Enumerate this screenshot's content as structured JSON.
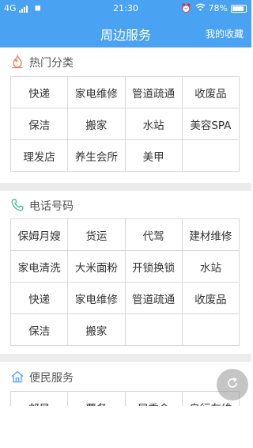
{
  "status": {
    "network": "4G",
    "time": "21:30",
    "battery": "78%"
  },
  "navbar": {
    "title": "周边服务",
    "favorites": "我的收藏"
  },
  "sections": {
    "hot": {
      "title": "热门分类",
      "icon": "flame-icon",
      "icon_color": "#f07d4f",
      "rows": [
        [
          "快递",
          "家电维修",
          "管道疏通",
          "收废品"
        ],
        [
          "保洁",
          "搬家",
          "水站",
          "美容SPA"
        ],
        [
          "理发店",
          "养生会所",
          "美甲",
          ""
        ]
      ]
    },
    "phone": {
      "title": "电话号码",
      "icon": "phone-icon",
      "icon_color": "#3cc08a",
      "rows": [
        [
          "保姆月嫂",
          "货运",
          "代驾",
          "建材维修"
        ],
        [
          "家电清洗",
          "大米面粉",
          "开锁换锁",
          "水站"
        ],
        [
          "快递",
          "家电维修",
          "管道疏通",
          "收废品"
        ],
        [
          "保洁",
          "搬家",
          "",
          ""
        ]
      ]
    },
    "convenience": {
      "title": "便民服务",
      "icon": "home-icon",
      "icon_color": "#4aa2f2",
      "rows": [
        [
          "邮局",
          "票务",
          "居委会",
          "自行车维"
        ]
      ]
    }
  },
  "colors": {
    "accent": "#4aa2f2",
    "separator": "#ececec",
    "grid_line": "#d9d9d9"
  }
}
